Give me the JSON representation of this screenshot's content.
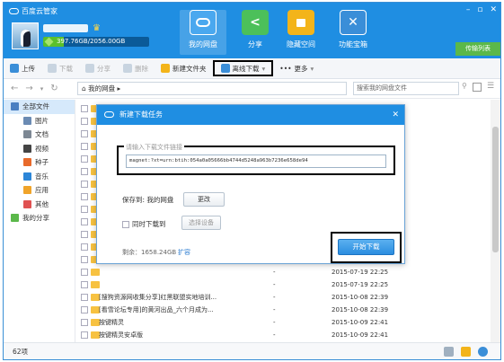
{
  "app": {
    "title": "百度云管家",
    "window_controls": [
      "–",
      "▫",
      "✕"
    ]
  },
  "user": {
    "quota": "397.76GB/2056.00GB",
    "quota_fraction": 0.193
  },
  "nav": [
    {
      "label": "我的网盘",
      "icon": "cloud-icon",
      "color": "#ffffff"
    },
    {
      "label": "分享",
      "icon": "share-icon",
      "color": "#4cc05a"
    },
    {
      "label": "隐藏空间",
      "icon": "lock-icon",
      "color": "#f3b41a"
    },
    {
      "label": "功能宝箱",
      "icon": "toolbox-icon",
      "color": "#3a8ed8"
    }
  ],
  "transfer_list": "传输列表",
  "toolbar": {
    "upload": "上传",
    "download": "下载",
    "share": "分享",
    "delete": "删除",
    "new_folder": "新建文件夹",
    "offline_download": "离线下载",
    "more": "更多"
  },
  "address": {
    "path": "我的网盘",
    "search_placeholder": "搜索我的网盘文件"
  },
  "sidebar": [
    {
      "label": "全部文件",
      "sub": false,
      "sel": true,
      "color": "#4a7fc1"
    },
    {
      "label": "图片",
      "sub": true,
      "sel": false,
      "color": "#6b8bb3"
    },
    {
      "label": "文档",
      "sub": true,
      "sel": false,
      "color": "#7d8894"
    },
    {
      "label": "视频",
      "sub": true,
      "sel": false,
      "color": "#444444"
    },
    {
      "label": "种子",
      "sub": true,
      "sel": false,
      "color": "#e86a2b"
    },
    {
      "label": "音乐",
      "sub": true,
      "sel": false,
      "color": "#2c86d8"
    },
    {
      "label": "应用",
      "sub": true,
      "sel": false,
      "color": "#f0a42a"
    },
    {
      "label": "其他",
      "sub": true,
      "sel": false,
      "color": "#e05252"
    },
    {
      "label": "我的分享",
      "sub": false,
      "sel": false,
      "color": "#5bb84a"
    }
  ],
  "files": [
    {
      "name": "",
      "size": "",
      "date": ""
    },
    {
      "name": "",
      "size": "",
      "date": ""
    },
    {
      "name": "",
      "size": "",
      "date": ""
    },
    {
      "name": "",
      "size": "",
      "date": ""
    },
    {
      "name": "",
      "size": "",
      "date": ""
    },
    {
      "name": "",
      "size": "",
      "date": ""
    },
    {
      "name": "",
      "size": "",
      "date": ""
    },
    {
      "name": "",
      "size": "",
      "date": ""
    },
    {
      "name": "",
      "size": "",
      "date": ""
    },
    {
      "name": "",
      "size": "",
      "date": ""
    },
    {
      "name": "",
      "size": "",
      "date": ""
    },
    {
      "name": "",
      "size": "",
      "date": ""
    },
    {
      "name": "",
      "size": "-",
      "date": "2015-07-19 22:25"
    },
    {
      "name": "",
      "size": "-",
      "date": "2015-07-19 22:25"
    },
    {
      "name": "",
      "size": "-",
      "date": "2015-07-19 22:25"
    },
    {
      "name": "[搜狗资源网收集分享]红黑联盟实地培训...",
      "size": "-",
      "date": "2015-10-08 22:39"
    },
    {
      "name": "[看雪论坛专用]的黄河出品_六个月成为...",
      "size": "-",
      "date": "2015-10-08 22:39"
    },
    {
      "name": "按键精灵",
      "size": "-",
      "date": "2015-10-09 22:41"
    },
    {
      "name": "按键精灵安卓版",
      "size": "-",
      "date": "2015-10-09 22:41"
    }
  ],
  "status": {
    "count": "62项"
  },
  "dialog": {
    "title": "新建下载任务",
    "url_label": "请输入下载文件链接",
    "url": "magnet:?xt=urn:btih:054a0a05666bb4744d5248a963b7236e658de94",
    "save_to": "保存到: 我的网盘",
    "change": "更改",
    "sync_label": "同时下载到",
    "select_device": "选择设备",
    "remaining": "剩余：1658.24GB",
    "expand": "扩容",
    "start": "开始下载",
    "close": "✕"
  }
}
